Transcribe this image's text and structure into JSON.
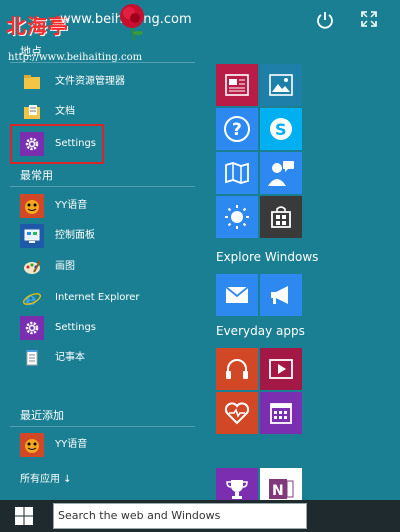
{
  "header": {
    "logo_cn": "北海亭",
    "logo_www": "www.beihaiting.com",
    "logo_url": "http://www.beihaiting.com"
  },
  "left": {
    "place_title": "地点",
    "place_items": [
      {
        "label": "文件资源管理器",
        "icon": "folder-icon"
      },
      {
        "label": "文档",
        "icon": "documents-icon"
      },
      {
        "label": "Settings",
        "icon": "gear-icon"
      }
    ],
    "common_title": "最常用",
    "common_items": [
      {
        "label": "YY语音",
        "icon": "yy-icon"
      },
      {
        "label": "控制面板",
        "icon": "control-panel-icon"
      },
      {
        "label": "画图",
        "icon": "paint-icon"
      },
      {
        "label": "Internet Explorer",
        "icon": "ie-icon"
      },
      {
        "label": "Settings",
        "icon": "gear-icon"
      },
      {
        "label": "记事本",
        "icon": "notepad-icon"
      }
    ],
    "recent_title": "最近添加",
    "recent_items": [
      {
        "label": "YY语音",
        "icon": "yy-icon"
      }
    ],
    "all_apps": "所有应用 ↓"
  },
  "tiles": {
    "group1": "Explore Windows",
    "group2": "Everyday apps",
    "colors": {
      "red": "#b91d47",
      "orange": "#d24726",
      "blue": "#2d89ef",
      "skype": "#00aff0",
      "purple": "#7b2fb0",
      "gray": "#3a3a3a",
      "darkred": "#a31844"
    }
  },
  "taskbar": {
    "search_placeholder": "Search the web and Windows"
  }
}
